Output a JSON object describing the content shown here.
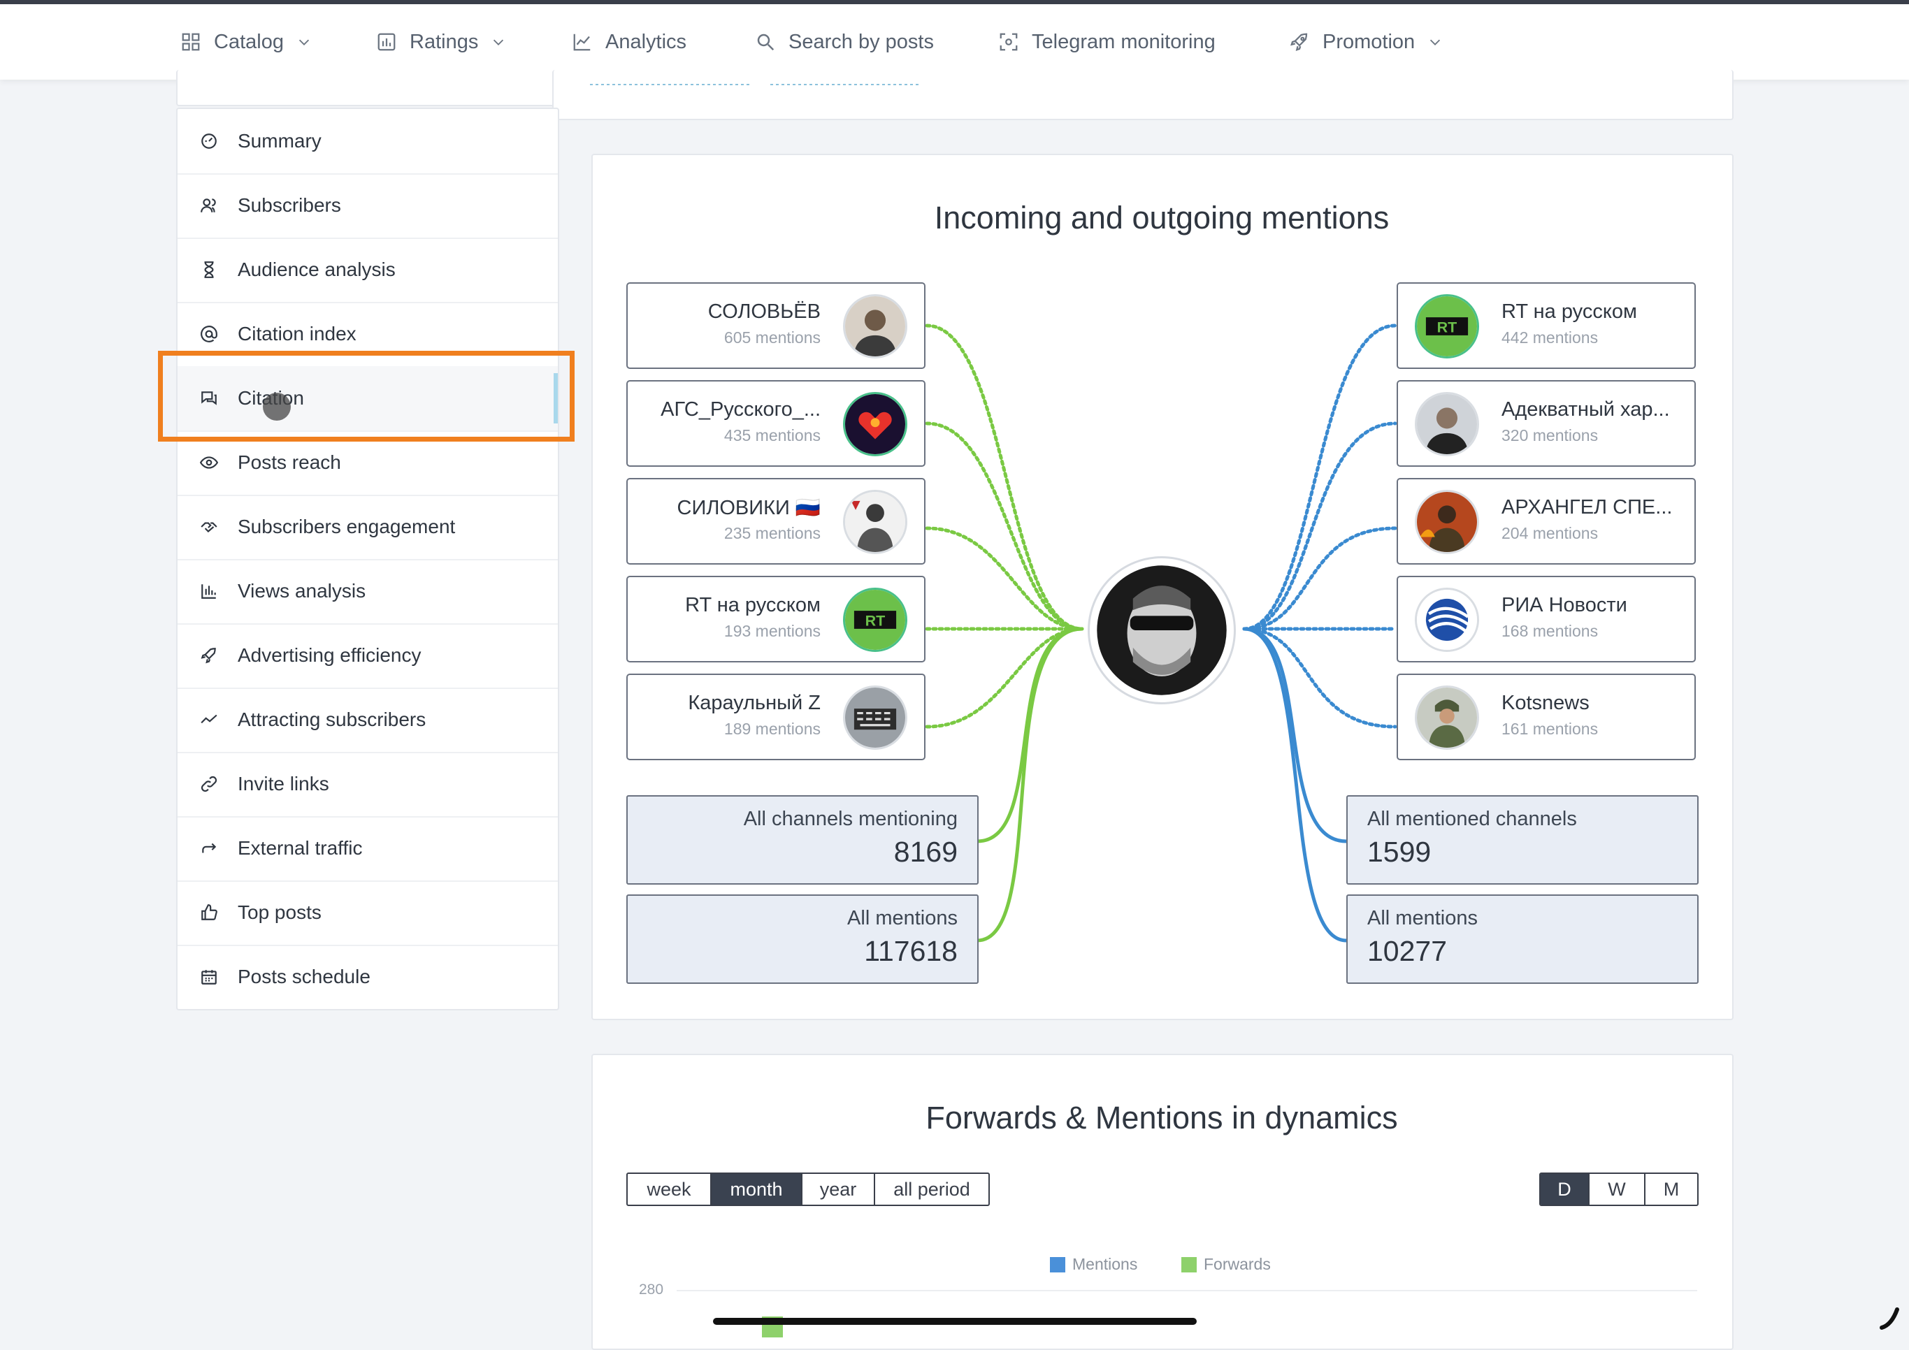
{
  "nav": [
    {
      "label": "Catalog",
      "icon": "grid-icon",
      "dropdown": true
    },
    {
      "label": "Ratings",
      "icon": "bar-chart-icon",
      "dropdown": true
    },
    {
      "label": "Analytics",
      "icon": "line-chart-icon",
      "dropdown": false
    },
    {
      "label": "Search by posts",
      "icon": "search-icon",
      "dropdown": false
    },
    {
      "label": "Telegram monitoring",
      "icon": "scan-icon",
      "dropdown": false
    },
    {
      "label": "Promotion",
      "icon": "rocket-icon",
      "dropdown": true
    }
  ],
  "sidebar": {
    "items": [
      {
        "label": "Summary",
        "icon": "dashboard-icon"
      },
      {
        "label": "Subscribers",
        "icon": "users-icon"
      },
      {
        "label": "Audience analysis",
        "icon": "hourglass-icon"
      },
      {
        "label": "Citation index",
        "icon": "at-icon"
      },
      {
        "label": "Citation",
        "icon": "chat-icon",
        "active": true
      },
      {
        "label": "Posts reach",
        "icon": "eye-icon"
      },
      {
        "label": "Subscribers engagement",
        "icon": "handshake-icon"
      },
      {
        "label": "Views analysis",
        "icon": "bars-icon"
      },
      {
        "label": "Advertising efficiency",
        "icon": "rocket-icon"
      },
      {
        "label": "Attracting subscribers",
        "icon": "trend-icon"
      },
      {
        "label": "Invite links",
        "icon": "link-icon"
      },
      {
        "label": "External traffic",
        "icon": "share-arrow-icon"
      },
      {
        "label": "Top posts",
        "icon": "thumbs-up-icon"
      },
      {
        "label": "Posts schedule",
        "icon": "calendar-icon"
      }
    ]
  },
  "mentions": {
    "title": "Incoming and outgoing mentions",
    "incoming": [
      {
        "name": "СОЛОВЬЁВ",
        "count": "605 mentions"
      },
      {
        "name": "АГС_Русского_...",
        "count": "435 mentions"
      },
      {
        "name": "СИЛОВИКИ 🇷🇺",
        "count": "235 mentions"
      },
      {
        "name": "RT на русском",
        "count": "193 mentions"
      },
      {
        "name": "Караульный Z",
        "count": "189 mentions"
      }
    ],
    "outgoing": [
      {
        "name": "RT на русском",
        "count": "442 mentions"
      },
      {
        "name": "Адекватный хар...",
        "count": "320 mentions"
      },
      {
        "name": "АРХАНГЕЛ СПЕ...",
        "count": "204 mentions"
      },
      {
        "name": "РИА Новости",
        "count": "168 mentions"
      },
      {
        "name": "Kotsnews",
        "count": "161 mentions"
      }
    ],
    "left_stats": {
      "channels_label": "All channels mentioning",
      "channels_value": "8169",
      "mentions_label": "All mentions",
      "mentions_value": "117618"
    },
    "right_stats": {
      "channels_label": "All mentioned channels",
      "channels_value": "1599",
      "mentions_label": "All mentions",
      "mentions_value": "10277"
    },
    "colors": {
      "incoming": "#7ac943",
      "outgoing": "#3a8ad0"
    }
  },
  "dynamics": {
    "title": "Forwards & Mentions in dynamics",
    "periods": [
      "week",
      "month",
      "year",
      "all period"
    ],
    "active_period": "month",
    "granularity": [
      "D",
      "W",
      "M"
    ],
    "active_granularity": "D",
    "legend": [
      {
        "label": "Mentions",
        "color": "#4a90d9"
      },
      {
        "label": "Forwards",
        "color": "#8ed16b"
      }
    ],
    "y_tick": "280"
  }
}
